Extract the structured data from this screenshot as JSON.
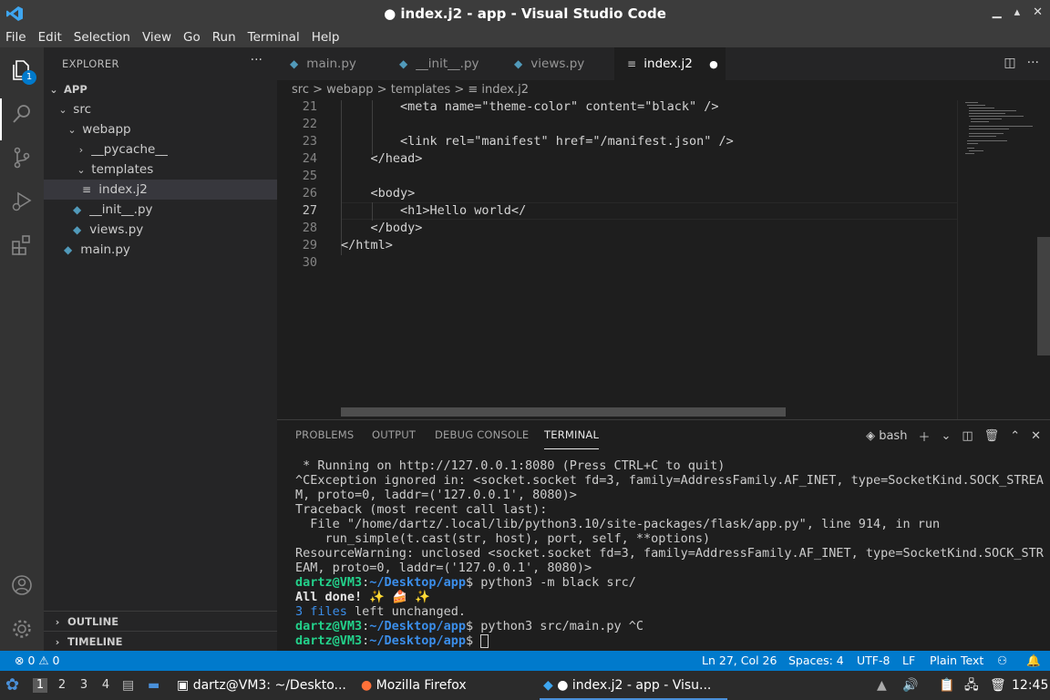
{
  "window": {
    "title": "● index.j2 - app - Visual Studio Code",
    "controls": [
      "minimize-icon",
      "maximize-icon",
      "close-icon"
    ]
  },
  "menu": [
    "File",
    "Edit",
    "Selection",
    "View",
    "Go",
    "Run",
    "Terminal",
    "Help"
  ],
  "activity": {
    "explorer_badge": "1"
  },
  "explorer": {
    "title": "EXPLORER",
    "more": "···",
    "root": "APP",
    "tree": [
      "src",
      "webapp",
      "__pycache__",
      "templates",
      "index.j2",
      "__init__.py",
      "views.py",
      "main.py"
    ],
    "outline": "OUTLINE",
    "timeline": "TIMELINE"
  },
  "tabs": [
    "main.py",
    "__init__.py",
    "views.py",
    "index.j2"
  ],
  "tab_dirty_marker": "●",
  "breadcrumbs": [
    "src",
    "webapp",
    "templates",
    "index.j2"
  ],
  "crumb_sep": ">",
  "editor": {
    "line_numbers": [
      "21",
      "22",
      "23",
      "24",
      "25",
      "26",
      "27",
      "28",
      "29",
      "30"
    ],
    "lines": [
      "        <meta name=\"theme-color\" content=\"black\" />",
      "",
      "        <link rel=\"manifest\" href=\"/manifest.json\" />",
      "    </head>",
      "",
      "    <body>",
      "        <h1>Hello world</",
      "    </body>",
      "</html>",
      ""
    ]
  },
  "panel": {
    "tabs": [
      "PROBLEMS",
      "OUTPUT",
      "DEBUG CONSOLE",
      "TERMINAL"
    ],
    "shell": "bash",
    "terminal": {
      "l1": " * Running on http://127.0.0.1:8080 (Press CTRL+C to quit)",
      "l2": "^CException ignored in: <socket.socket fd=3, family=AddressFamily.AF_INET, type=SocketKind.SOCK_STREA",
      "l3": "M, proto=0, laddr=('127.0.0.1', 8080)>",
      "l4": "Traceback (most recent call last):",
      "l5": "  File \"/home/dartz/.local/lib/python3.10/site-packages/flask/app.py\", line 914, in run",
      "l6": "    run_simple(t.cast(str, host), port, self, **options)",
      "l7": "ResourceWarning: unclosed <socket.socket fd=3, family=AddressFamily.AF_INET, type=SocketKind.SOCK_STR",
      "l8": "EAM, proto=0, laddr=('127.0.0.1', 8080)>",
      "user": "dartz@VM3",
      "colon": ":",
      "path": "~/Desktop/app",
      "dollar": "$",
      "cmd1": " python3 -m black src/",
      "done": "All done!",
      "done_icons": " ✨ 🍰 ✨",
      "files_count": "3 files",
      "files_rest": " left unchanged.",
      "cmd2": " python3 src/main.py ^C"
    }
  },
  "status": {
    "errors": "⊗ 0 ⚠ 0",
    "position": "Ln 27, Col 26",
    "spaces": "Spaces: 4",
    "encoding": "UTF-8",
    "eol": "LF",
    "language": "Plain Text"
  },
  "taskbar": {
    "workspaces": [
      "1",
      "2",
      "3",
      "4"
    ],
    "terminal_task": "dartz@VM3: ~/Deskto...",
    "firefox_task": "Mozilla Firefox",
    "vscode_task": "● index.j2 - app - Visu...",
    "clock": "12:45"
  }
}
